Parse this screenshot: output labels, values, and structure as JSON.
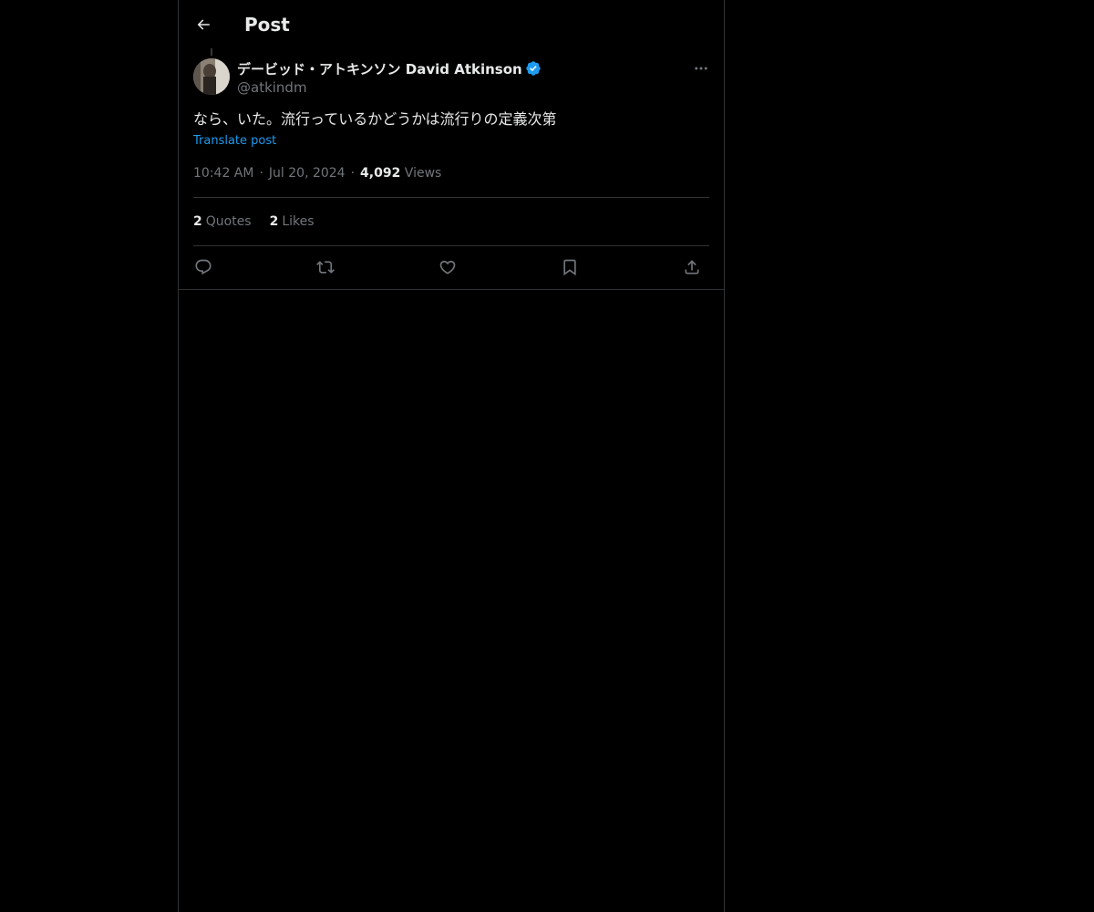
{
  "header": {
    "title": "Post",
    "back_icon": "arrow-left-icon"
  },
  "post": {
    "author": {
      "display_name": "デービッド・アトキンソン David Atkinson",
      "handle": "@atkindm",
      "verified": true,
      "verified_color": "#1d9bf0"
    },
    "text": "なら、いた。流行っているかどうかは流行りの定義次第",
    "translate_label": "Translate post",
    "time": "10:42 AM",
    "date": "Jul 20, 2024",
    "views_count": "4,092",
    "views_label": "Views",
    "separator": "·",
    "stats": {
      "quotes_count": "2",
      "quotes_label": "Quotes",
      "likes_count": "2",
      "likes_label": "Likes"
    },
    "actions": [
      "reply-icon",
      "repost-icon",
      "like-icon",
      "bookmark-icon",
      "share-icon"
    ]
  },
  "colors": {
    "background": "#000000",
    "text": "#e7e9ea",
    "muted": "#71767b",
    "accent": "#1d9bf0",
    "border": "#2f3336"
  }
}
